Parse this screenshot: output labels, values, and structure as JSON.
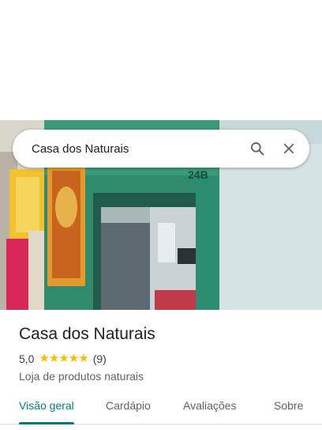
{
  "search": {
    "value": "Casa dos Naturais",
    "search_icon": "search-icon",
    "close_icon": "close-icon"
  },
  "photo": {
    "storefront_sign": "24B"
  },
  "place": {
    "name": "Casa dos Naturais",
    "rating": "5,0",
    "stars": "★★★★★",
    "review_count": "(9)",
    "category": "Loja de produtos naturais"
  },
  "tabs": [
    {
      "label": "Visão geral",
      "active": true
    },
    {
      "label": "Cardápio",
      "active": false
    },
    {
      "label": "Avaliações",
      "active": false
    },
    {
      "label": "Sobre",
      "active": false
    }
  ],
  "colors": {
    "accent": "#0b7a75",
    "star": "#fbbc04"
  }
}
